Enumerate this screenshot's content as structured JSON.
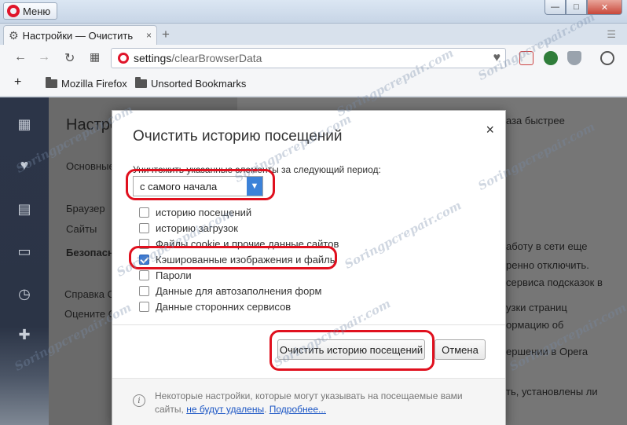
{
  "window": {
    "menu_label": "Меню",
    "controls": {
      "minimize": "—",
      "maximize": "□",
      "close": "✕"
    }
  },
  "tab": {
    "title": "Настройки — Очистить",
    "close": "×",
    "new_tab": "+"
  },
  "address": {
    "host": "settings",
    "path": "/clearBrowserData"
  },
  "bookmarks": {
    "add": "+",
    "items": [
      "Mozilla Firefox",
      "Unsorted Bookmarks"
    ]
  },
  "settings_bg": {
    "title": "Настро",
    "items": [
      "Основные",
      "Браузер",
      "Сайты",
      "Безопасно",
      "Справка O",
      "Оцените O"
    ],
    "right_lines": [
      "аза быстрее",
      "аботу в сети еще",
      "ренно отключить.",
      "сервиса подсказок в",
      "узки страниц",
      "ормацию об",
      "ершении в Opera",
      "ть, установлены ли"
    ]
  },
  "dialog": {
    "title": "Очистить историю посещений",
    "close": "×",
    "period_label": "Уничтожить указанные элементы за следующий период:",
    "period_value": "с самого начала",
    "checkboxes": [
      {
        "label": "историю посещений",
        "checked": false
      },
      {
        "label": "историю загрузок",
        "checked": false
      },
      {
        "label": "Файлы cookie и прочие данные сайтов",
        "checked": false
      },
      {
        "label": "Кэшированные изображения и файлы",
        "checked": true
      },
      {
        "label": "Пароли",
        "checked": false
      },
      {
        "label": "Данные для автозаполнения форм",
        "checked": false
      },
      {
        "label": "Данные сторонних сервисов",
        "checked": false
      }
    ],
    "clear_button": "Очистить историю посещений",
    "cancel_button": "Отмена",
    "footer_text": "Некоторые настройки, которые могут указывать на посещаемые вами сайты,",
    "footer_link1": "не будут удалены",
    "footer_sep": ".",
    "footer_link2": "Подробнее..."
  },
  "watermark": "Soringpcrepair.com",
  "colors": {
    "accent": "#3c82d8",
    "highlight": "#e0101e",
    "opera_red": "#e0152b"
  }
}
